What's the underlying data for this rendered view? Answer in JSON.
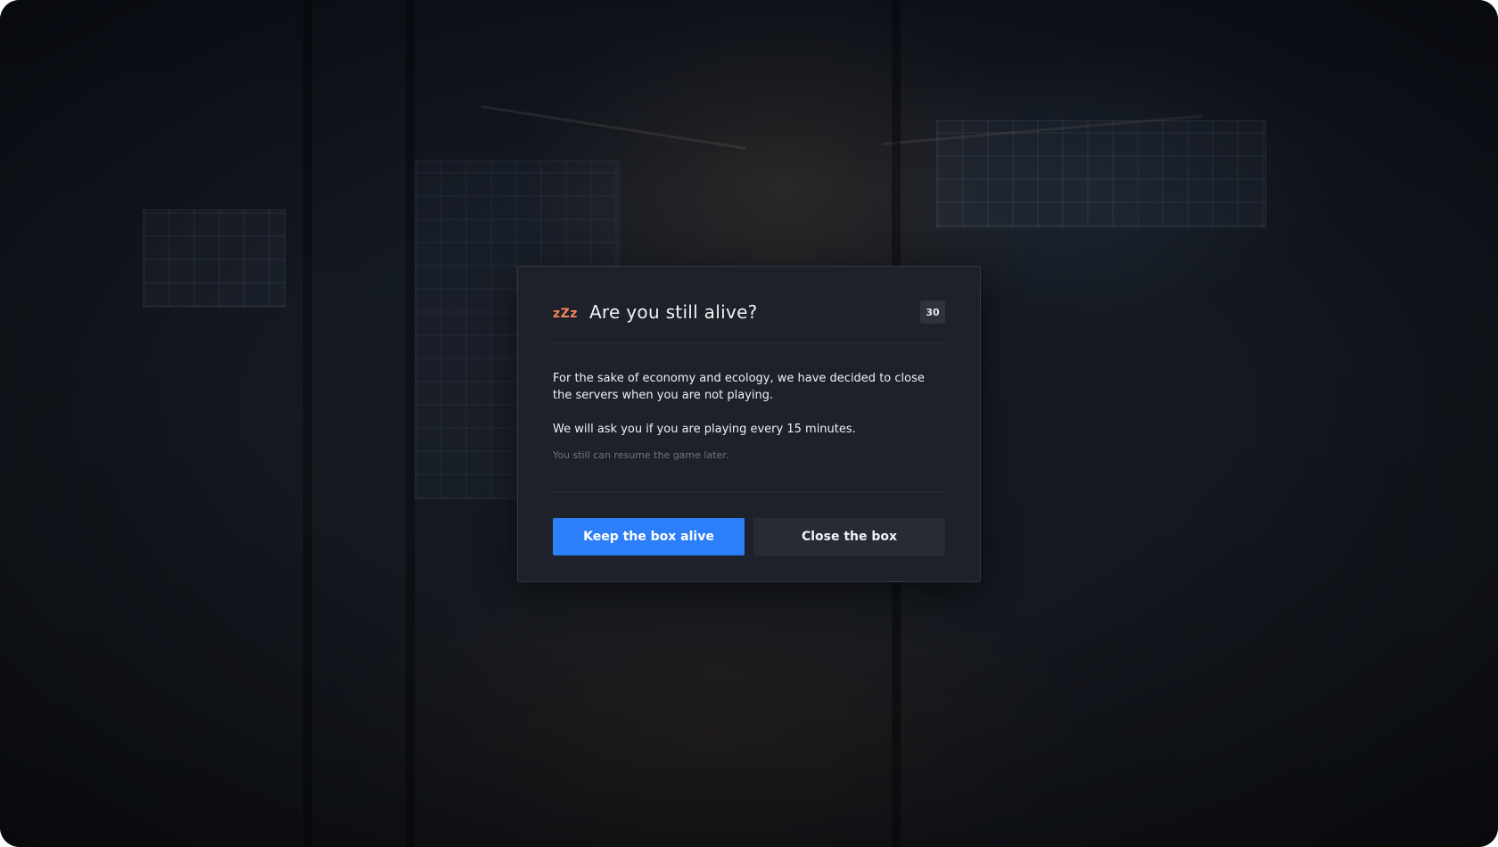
{
  "dialog": {
    "icon_text": "zZz",
    "title": "Are you still alive?",
    "timer": "30",
    "paragraph_1": "For the sake of economy and ecology, we have decided to close the servers when you are not playing.",
    "paragraph_2": "We will ask you if you are playing every 15 minutes.",
    "note": "You still can resume the game later.",
    "primary_button": "Keep the box alive",
    "secondary_button": "Close the box"
  },
  "colors": {
    "accent": "#2d7ff9",
    "icon": "#f0845a",
    "dialog_background": "#1e2129"
  }
}
